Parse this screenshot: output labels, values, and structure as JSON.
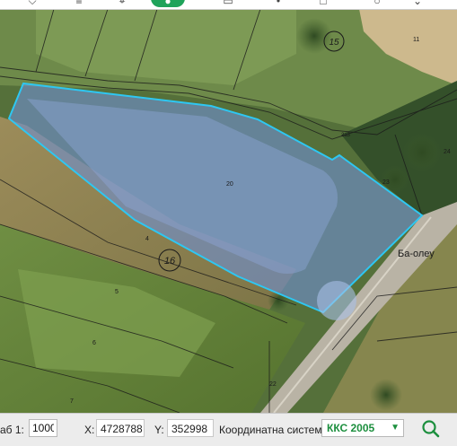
{
  "map": {
    "parcel_numbers": [
      "20",
      "4",
      "5",
      "6",
      "7",
      "11",
      "24",
      "22",
      "23",
      "2a3"
    ],
    "block_numbers": [
      "16",
      "15"
    ],
    "road_label": "Ба-олеу",
    "colors": {
      "highlight_fill": "#6f8fd0",
      "highlight_stroke": "#2ec7f2",
      "parcel_line": "#1a1a1a"
    }
  },
  "toolbar": {
    "icons": [
      "pin-icon",
      "layers-add-icon",
      "target-icon",
      "tools-icon",
      "book-icon",
      "info-icon",
      "chevron-icon"
    ]
  },
  "statusbar": {
    "scale_label": "аб 1:",
    "scale_value": "1000",
    "x_label": "X:",
    "x_value": "4728788",
    "y_label": "Y:",
    "y_value": "352998",
    "crs_label": "Координатна система:",
    "crs_value": "ККС 2005",
    "search_icon": "search-icon"
  }
}
